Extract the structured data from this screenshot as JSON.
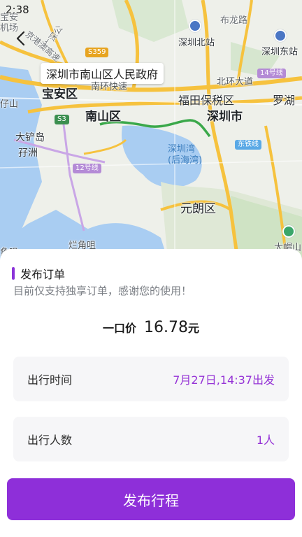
{
  "status_bar": {
    "time": "2:38"
  },
  "map": {
    "callout": "深圳市南山区人民政府",
    "labels": {
      "baoan_district": "宝安区",
      "nanshan_district": "南山区",
      "futian_bonded": "福田保税区",
      "shenzhen_city": "深圳市",
      "luohu": "罗湖",
      "shenzhen_bay": "深圳湾\n(后海湾)",
      "yuen_long": "元朗区",
      "dachan_island": "大铲岛",
      "zi_island": "孖洲",
      "shenzhen_north": "深圳北站",
      "shenzhen_east": "深圳东站",
      "bulong_road": "布龙路",
      "baoan_airport": "宝安\n机场",
      "guangshen": "广深公",
      "jingang_ao": "京港澳高速",
      "beihuan": "北环大道",
      "nanhai": "南环快速",
      "lantau_cape": "烂角咀",
      "tai_mo_shan": "大帽山",
      "lingding": "仔山",
      "jiaozui": "角咀"
    },
    "road_tags": {
      "s359": "S359",
      "s3": "S3",
      "line12": "12号线",
      "line14": "14号线",
      "east_rail": "东铁线"
    }
  },
  "sheet": {
    "title": "发布订单",
    "subtitle": "目前仅支持独享订单，感谢您的使用！",
    "price_label": "一口价",
    "price_value": "16.78",
    "price_unit": "元",
    "time_label": "出行时间",
    "time_value": "7月27日,14:37出发",
    "people_label": "出行人数",
    "people_value": "1人",
    "submit_label": "发布行程"
  },
  "colors": {
    "accent": "#8e2fd9",
    "accent_text": "#9533d6",
    "route": "#3aa84a"
  }
}
